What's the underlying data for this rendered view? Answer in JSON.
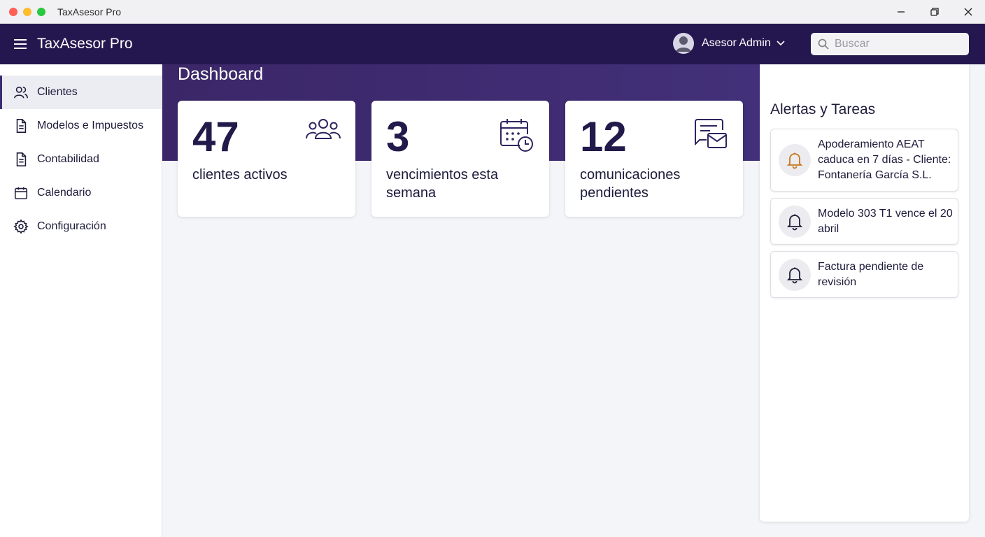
{
  "window": {
    "title": "TaxAsesor Pro"
  },
  "header": {
    "app_title": "TaxAsesor Pro",
    "user_name": "Asesor Admin",
    "search_placeholder": "Buscar"
  },
  "sidebar": {
    "items": [
      {
        "label": "Clientes",
        "icon": "users-icon",
        "active": true
      },
      {
        "label": "Modelos e Impuestos",
        "icon": "document-icon",
        "active": false
      },
      {
        "label": "Contabilidad",
        "icon": "document-icon",
        "active": false
      },
      {
        "label": "Calendario",
        "icon": "calendar-icon",
        "active": false
      },
      {
        "label": "Configuración",
        "icon": "gear-icon",
        "active": false
      }
    ]
  },
  "dashboard": {
    "title": "Dashboard",
    "cards": [
      {
        "value": "47",
        "label": "clientes activos",
        "icon": "users-icon"
      },
      {
        "value": "3",
        "label": "vencimientos esta semana",
        "icon": "calendar-clock-icon"
      },
      {
        "value": "12",
        "label": "comunicaciones pendientes",
        "icon": "message-mail-icon"
      }
    ]
  },
  "alerts": {
    "title": "Alertas y Tareas",
    "items": [
      {
        "text": "Apoderamiento AEAT caduca en 7 días - Cliente: Fontanería García S.L.",
        "icon": "bell-icon",
        "color": "#c8761a"
      },
      {
        "text": "Modelo 303 T1 vence el 20 abril",
        "icon": "bell-icon",
        "color": "#1d1b3a"
      },
      {
        "text": "Factura pendiente de revisión",
        "icon": "bell-icon",
        "color": "#1d1b3a"
      }
    ]
  },
  "colors": {
    "header_bg": "#24174f",
    "hero_bg": "#3f2c72",
    "accent": "#3a2c74",
    "warning": "#c8761a"
  }
}
